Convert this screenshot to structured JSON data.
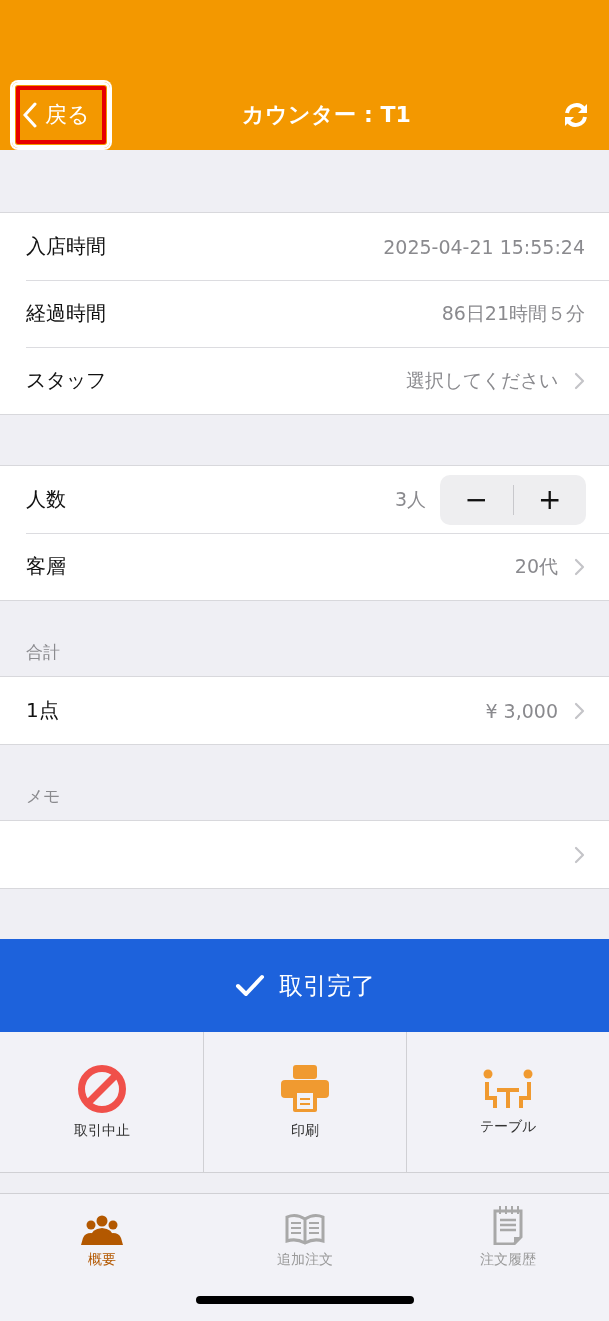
{
  "header": {
    "back": {
      "label": "戻る",
      "highlighted": true
    },
    "title": "カウンター : T1"
  },
  "sections": [
    {
      "rows": [
        {
          "kind": "info",
          "label": "入店時間",
          "value": "2025-04-21 15:55:24"
        },
        {
          "kind": "info",
          "label": "経過時間",
          "value": "86日21時間５分"
        },
        {
          "kind": "link",
          "label": "スタッフ",
          "value": "選択してください"
        }
      ]
    },
    {
      "rows": [
        {
          "kind": "stepper",
          "label": "人数",
          "value": "3人",
          "minus": "−",
          "plus": "+"
        },
        {
          "kind": "link",
          "label": "客層",
          "value": "20代"
        }
      ]
    },
    {
      "title": "合計",
      "rows": [
        {
          "kind": "link",
          "label": "1点",
          "value": "¥ 3,000"
        }
      ]
    },
    {
      "title": "メモ",
      "rows": [
        {
          "kind": "link"
        }
      ]
    }
  ],
  "complete_button": {
    "label": "取引完了"
  },
  "actions": [
    {
      "kind": "cancel",
      "label": "取引中止"
    },
    {
      "kind": "print",
      "label": "印刷"
    },
    {
      "kind": "table",
      "label": "テーブル"
    }
  ],
  "tabs": [
    {
      "kind": "people",
      "label": "概要",
      "selected": true
    },
    {
      "kind": "book",
      "label": "追加注文",
      "selected": false
    },
    {
      "kind": "notepad",
      "label": "注文履歴",
      "selected": false
    }
  ]
}
